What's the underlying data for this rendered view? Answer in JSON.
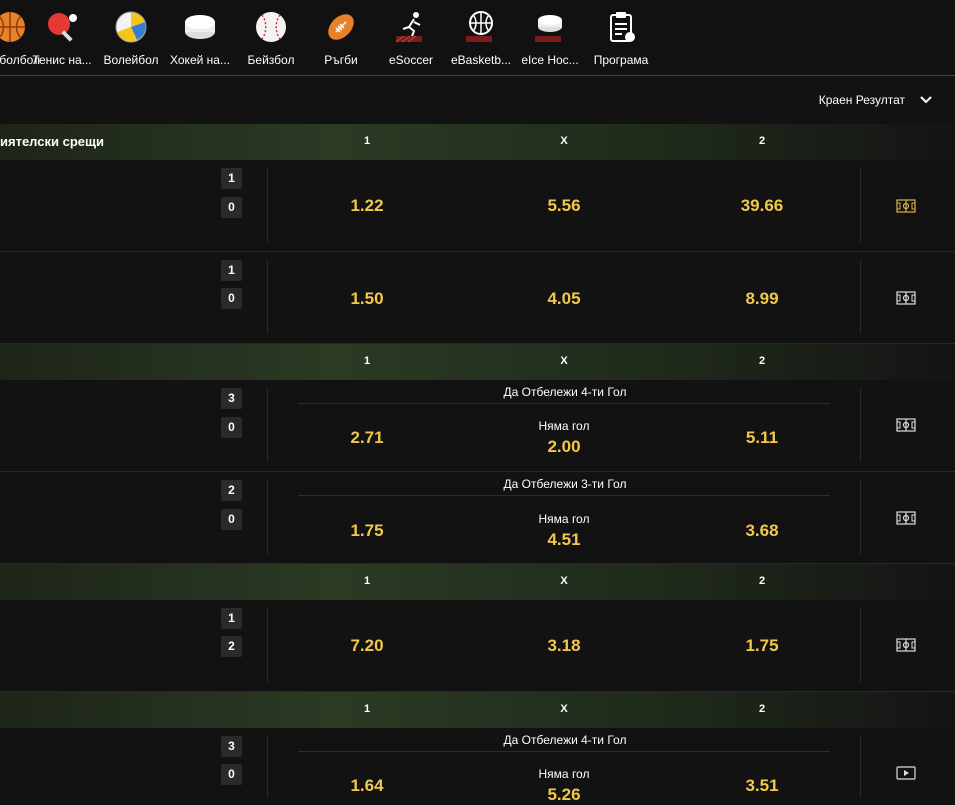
{
  "sports_nav": [
    {
      "name": "basketball",
      "label": "болбол",
      "icon": "basketball-icon"
    },
    {
      "name": "table-tennis",
      "label": "Тенис на...",
      "icon": "table-tennis-icon"
    },
    {
      "name": "volleyball",
      "label": "Волейбол",
      "icon": "volleyball-icon"
    },
    {
      "name": "ice-hockey",
      "label": "Хокей на...",
      "icon": "hockey-puck-icon"
    },
    {
      "name": "baseball",
      "label": "Бейзбол",
      "icon": "baseball-icon"
    },
    {
      "name": "rugby",
      "label": "Ръгби",
      "icon": "rugby-ball-icon"
    },
    {
      "name": "esoccer",
      "label": "eSoccer",
      "icon": "esoccer-icon"
    },
    {
      "name": "ebasketball",
      "label": "eBasketb...",
      "icon": "ebasketball-icon"
    },
    {
      "name": "eice-hockey",
      "label": "eIce Hoc...",
      "icon": "eice-hockey-icon"
    },
    {
      "name": "program",
      "label": "Програма",
      "icon": "program-clipboard-icon"
    }
  ],
  "market_selector": {
    "label": "Краен Резултат",
    "icon": "chevron-down-icon"
  },
  "sections": [
    {
      "title": "иятелски срещи",
      "col1": "1",
      "colx": "X",
      "col2": "2"
    },
    {
      "title": "",
      "col1": "1",
      "colx": "X",
      "col2": "2"
    },
    {
      "title": "",
      "col1": "1",
      "colx": "X",
      "col2": "2"
    },
    {
      "title": "",
      "col1": "1",
      "colx": "X",
      "col2": "2"
    }
  ],
  "events": [
    {
      "score_home": "1",
      "score_away": "0",
      "odd1": "1.22",
      "oddx": "5.56",
      "odd2": "39.66",
      "special": "",
      "no_goal": "",
      "icon": "field-icon"
    },
    {
      "score_home": "1",
      "score_away": "0",
      "odd1": "1.50",
      "oddx": "4.05",
      "odd2": "8.99",
      "special": "",
      "no_goal": "",
      "icon": "field-icon"
    },
    {
      "score_home": "3",
      "score_away": "0",
      "odd1": "2.71",
      "oddx": "2.00",
      "odd2": "5.11",
      "special": "Да Отбележи 4-ти Гол",
      "no_goal": "Няма гол",
      "icon": "field-icon"
    },
    {
      "score_home": "2",
      "score_away": "0",
      "odd1": "1.75",
      "oddx": "4.51",
      "odd2": "3.68",
      "special": "Да Отбележи 3-ти Гол",
      "no_goal": "Няма гол",
      "icon": "field-icon"
    },
    {
      "score_home": "1",
      "score_away": "2",
      "odd1": "7.20",
      "oddx": "3.18",
      "odd2": "1.75",
      "special": "",
      "no_goal": "",
      "icon": "field-icon"
    },
    {
      "score_home": "3",
      "score_away": "0",
      "odd1": "1.64",
      "oddx": "5.26",
      "odd2": "3.51",
      "special": "Да Отбележи 4-ти Гол",
      "no_goal": "Няма гол",
      "icon": "video-play-icon"
    }
  ],
  "colors": {
    "odds": "#f2c84b",
    "accent_line": "#3a4a2a",
    "background": "#121212"
  }
}
